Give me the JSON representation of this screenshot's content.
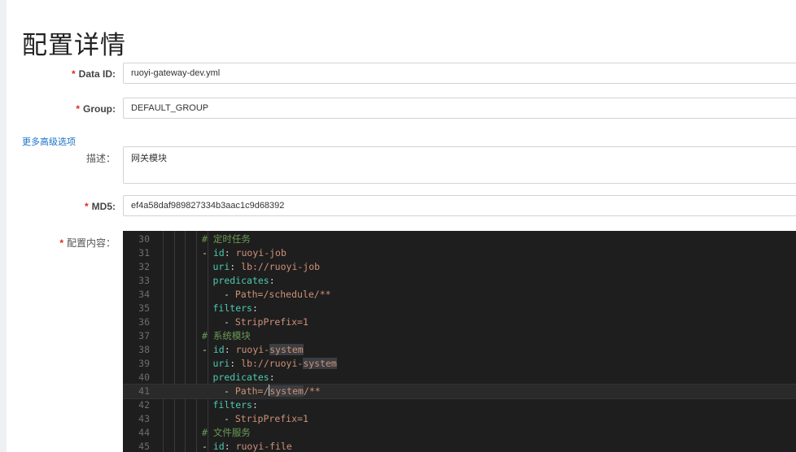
{
  "page": {
    "title": "配置详情"
  },
  "form": {
    "data_id": {
      "label": "Data ID:",
      "value": "ruoyi-gateway-dev.yml"
    },
    "group": {
      "label": "Group:",
      "value": "DEFAULT_GROUP"
    },
    "more_options": "更多高级选项",
    "description": {
      "label": "描述：",
      "value": "网关模块"
    },
    "md5": {
      "label": "MD5:",
      "value": "ef4a58daf989827334b3aac1c9d68392"
    },
    "content_label": "配置内容：",
    "required_mark": "*"
  },
  "editor": {
    "lines": [
      {
        "num": "30",
        "indent": 3,
        "segs": [
          [
            "c-comment",
            "# 定时任务"
          ]
        ]
      },
      {
        "num": "31",
        "indent": 3,
        "segs": [
          [
            "c-dash",
            "- "
          ],
          [
            "c-key",
            "id"
          ],
          [
            "c-dash",
            ": "
          ],
          [
            "c-val",
            "ruoyi-job"
          ]
        ]
      },
      {
        "num": "32",
        "indent": 4,
        "segs": [
          [
            "c-key",
            "uri"
          ],
          [
            "c-dash",
            ": "
          ],
          [
            "c-val",
            "lb://ruoyi-job"
          ]
        ]
      },
      {
        "num": "33",
        "indent": 4,
        "segs": [
          [
            "c-key",
            "predicates"
          ],
          [
            "c-dash",
            ":"
          ]
        ]
      },
      {
        "num": "34",
        "indent": 5,
        "segs": [
          [
            "c-dash",
            "- "
          ],
          [
            "c-val",
            "Path=/schedule/**"
          ]
        ]
      },
      {
        "num": "35",
        "indent": 4,
        "segs": [
          [
            "c-key",
            "filters"
          ],
          [
            "c-dash",
            ":"
          ]
        ]
      },
      {
        "num": "36",
        "indent": 5,
        "segs": [
          [
            "c-dash",
            "- "
          ],
          [
            "c-val",
            "StripPrefix=1"
          ]
        ]
      },
      {
        "num": "37",
        "indent": 3,
        "segs": [
          [
            "c-comment",
            "# 系统模块"
          ]
        ]
      },
      {
        "num": "38",
        "indent": 3,
        "segs": [
          [
            "c-dash",
            "- "
          ],
          [
            "c-key",
            "id"
          ],
          [
            "c-dash",
            ": "
          ],
          [
            "c-val",
            "ruoyi-"
          ],
          [
            "c-val c-hl",
            "system"
          ]
        ]
      },
      {
        "num": "39",
        "indent": 4,
        "segs": [
          [
            "c-key",
            "uri"
          ],
          [
            "c-dash",
            ": "
          ],
          [
            "c-val",
            "lb://ruoyi-"
          ],
          [
            "c-val c-hl",
            "system"
          ]
        ]
      },
      {
        "num": "40",
        "indent": 4,
        "segs": [
          [
            "c-key",
            "predicates"
          ],
          [
            "c-dash",
            ":"
          ]
        ]
      },
      {
        "num": "41",
        "indent": 5,
        "current": true,
        "segs": [
          [
            "c-dash",
            "- "
          ],
          [
            "c-val",
            "Path=/"
          ],
          [
            "cursor",
            ""
          ],
          [
            "c-val c-hl",
            "system"
          ],
          [
            "c-val",
            "/**"
          ]
        ]
      },
      {
        "num": "42",
        "indent": 4,
        "segs": [
          [
            "c-key",
            "filters"
          ],
          [
            "c-dash",
            ":"
          ]
        ]
      },
      {
        "num": "43",
        "indent": 5,
        "segs": [
          [
            "c-dash",
            "- "
          ],
          [
            "c-val",
            "StripPrefix=1"
          ]
        ]
      },
      {
        "num": "44",
        "indent": 3,
        "segs": [
          [
            "c-comment",
            "# 文件服务"
          ]
        ]
      },
      {
        "num": "45",
        "indent": 3,
        "segs": [
          [
            "c-dash",
            "- "
          ],
          [
            "c-key",
            "id"
          ],
          [
            "c-dash",
            ": "
          ],
          [
            "c-val",
            "ruoyi-file"
          ]
        ]
      }
    ]
  }
}
